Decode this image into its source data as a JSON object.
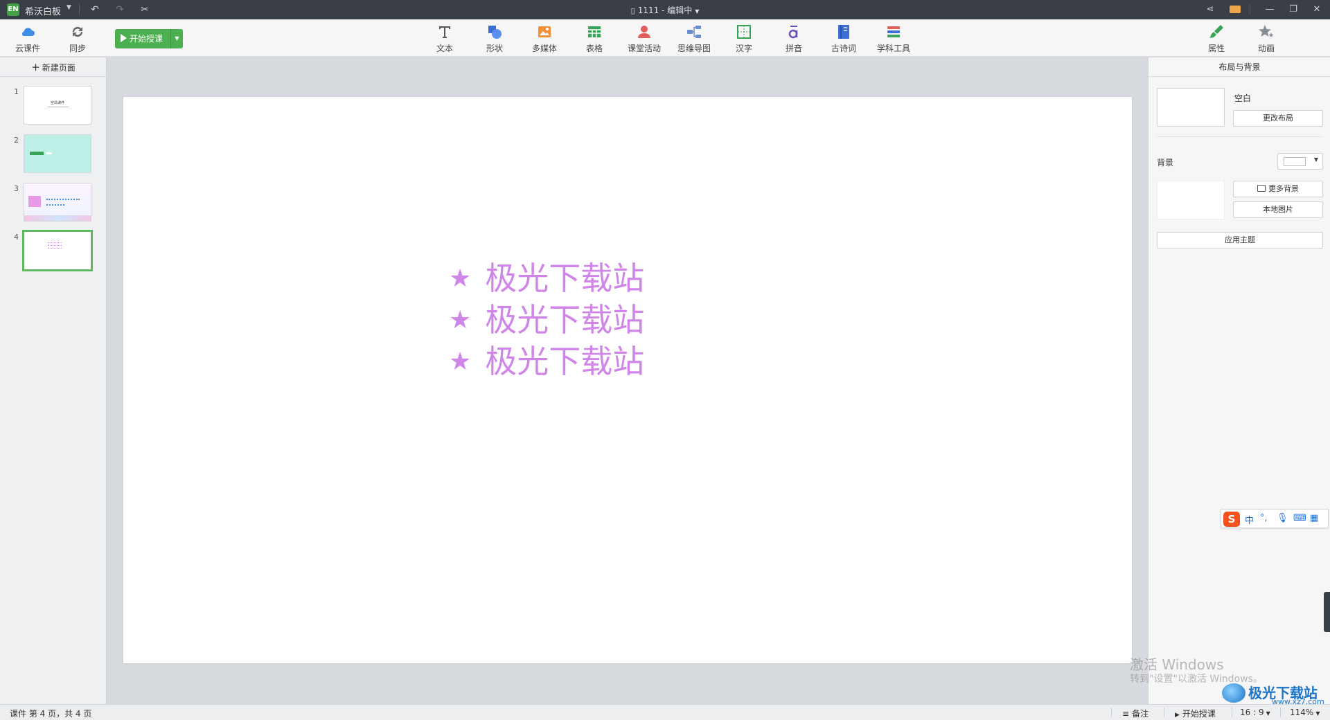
{
  "titlebar": {
    "logo_text": "EN",
    "app_name": "希沃白板",
    "doc_title": "1111 - 编辑中"
  },
  "toolbar": {
    "cloud_label": "云课件",
    "sync_label": "同步",
    "start_label": "开始授课",
    "tools": [
      {
        "label": "文本",
        "icon": "text-icon"
      },
      {
        "label": "形状",
        "icon": "shape-icon"
      },
      {
        "label": "多媒体",
        "icon": "media-icon"
      },
      {
        "label": "表格",
        "icon": "table-icon"
      },
      {
        "label": "课堂活动",
        "icon": "activity-icon"
      },
      {
        "label": "思维导图",
        "icon": "mindmap-icon"
      },
      {
        "label": "汉字",
        "icon": "hanzi-icon"
      },
      {
        "label": "拼音",
        "icon": "pinyin-icon"
      },
      {
        "label": "古诗词",
        "icon": "poem-icon"
      },
      {
        "label": "学科工具",
        "icon": "subject-tools-icon"
      }
    ],
    "properties_label": "属性",
    "animation_label": "动画"
  },
  "leftpanel": {
    "new_page_label": "新建页面",
    "pages": [
      {
        "num": "1"
      },
      {
        "num": "2"
      },
      {
        "num": "3"
      },
      {
        "num": "4"
      }
    ],
    "thumb1_title": "空白课件"
  },
  "slide": {
    "lines": [
      {
        "star": "★",
        "text": "极光下载站"
      },
      {
        "star": "★",
        "text": "极光下载站"
      },
      {
        "star": "★",
        "text": "极光下载站"
      }
    ]
  },
  "rightpanel": {
    "header": "布局与背景",
    "layout_name": "空白",
    "change_layout": "更改布局",
    "background_label": "背景",
    "more_backgrounds": "更多背景",
    "local_image": "本地图片",
    "apply_theme": "应用主题",
    "bg_color": "#ffffff"
  },
  "statusbar": {
    "page_info": "课件 第 4 页，共 4 页",
    "notes": "备注",
    "start": "开始授课",
    "ratio": "16 : 9",
    "zoom": "114%"
  },
  "ime": {
    "logo": "S",
    "lang": "中",
    "punct": "°,"
  },
  "overlay": {
    "activate_title": "激活 Windows",
    "activate_sub": "转到\"设置\"以激活 Windows。",
    "site_name": "极光下载站",
    "site_url": "www.xz7.com"
  },
  "colors": {
    "accent_green": "#4caf50",
    "slide_text": "#cf86e8",
    "titlebar_bg": "#3a3f47"
  }
}
